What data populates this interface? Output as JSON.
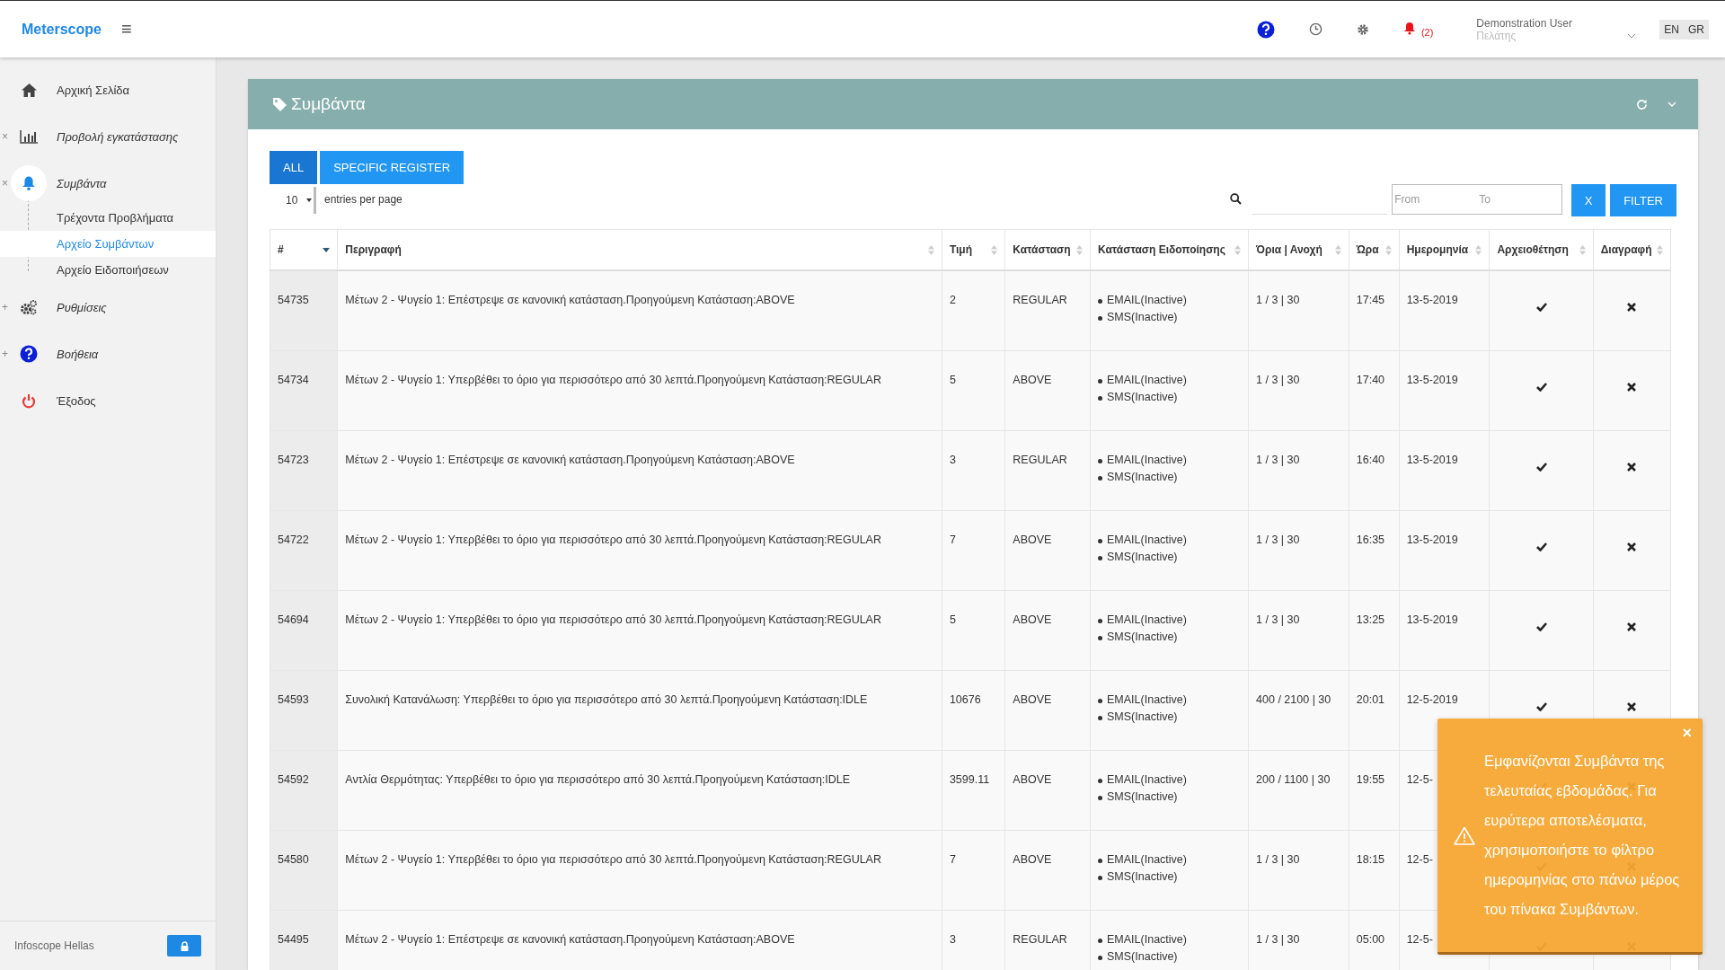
{
  "topbar": {
    "brand": "Meterscope",
    "menu": "≡",
    "notifications": "(2)",
    "user": {
      "name": "Demonstration User",
      "role": "Πελάτης"
    },
    "languages": [
      "EN",
      "GR"
    ]
  },
  "sidebar": {
    "items": [
      {
        "label": "Αρχική Σελίδα",
        "italic": false,
        "active": false
      },
      {
        "label": "Προβολή εγκατάστασης",
        "italic": true,
        "active": false,
        "toggle": "×"
      },
      {
        "label": "Συμβάντα",
        "italic": true,
        "active": true,
        "toggle": "×",
        "children": [
          {
            "label": "Τρέχοντα Προβλήματα",
            "selected": false
          },
          {
            "label": "Αρχείο Συμβάντων",
            "selected": true
          },
          {
            "label": "Αρχείο Ειδοποιήσεων",
            "selected": false
          }
        ]
      },
      {
        "label": "Ρυθμίσεις",
        "italic": true,
        "active": false,
        "toggle": "+"
      },
      {
        "label": "Βοήθεια",
        "italic": true,
        "active": false,
        "toggle": "+"
      },
      {
        "label": "Έξοδος",
        "italic": false,
        "active": false
      }
    ],
    "footer": "Infoscope Hellas"
  },
  "panel": {
    "title": "Συμβάντα",
    "tabs": [
      {
        "label": "ALL",
        "selected": true
      },
      {
        "label": "SPECIFIC REGISTER",
        "selected": false
      }
    ],
    "page_size": "10",
    "page_size_label": "entries per page",
    "from": {
      "placeholder": "From"
    },
    "to": {
      "placeholder": "To"
    },
    "clear_button": "X",
    "filter_button": "FILTER",
    "table": {
      "columns": [
        {
          "label": "#",
          "sorted": true
        },
        {
          "label": "Περιγραφή",
          "sorted": false
        },
        {
          "label": "Τιμή",
          "sorted": false
        },
        {
          "label": "Κατάσταση",
          "sorted": false
        },
        {
          "label": "Κατάσταση Ειδοποίησης",
          "sorted": false
        },
        {
          "label": "Όρια | Ανοχή",
          "sorted": false
        },
        {
          "label": "Ώρα",
          "sorted": false
        },
        {
          "label": "Ημερομηνία",
          "sorted": false
        },
        {
          "label": "Αρχειοθέτηση",
          "sorted": false
        },
        {
          "label": "Διαγραφή",
          "sorted": false
        }
      ],
      "rows": [
        {
          "id": "54735",
          "description": "Μέτων 2 - Ψυγείο 1: Επέστρεψε σε κανονική κατάσταση.Προηγούμενη Κατάσταση:ABOVE",
          "value": "2",
          "status": "REGULAR",
          "notifications": [
            "EMAIL(Inactive)",
            "SMS(Inactive)"
          ],
          "limits": "1 / 3 | 30",
          "time": "17:45",
          "date": "13-5-2019"
        },
        {
          "id": "54734",
          "description": "Μέτων 2 - Ψυγείο 1: Υπερβέθει το όριο για περισσότερο από 30 λεπτά.Προηγούμενη Κατάσταση:REGULAR",
          "value": "5",
          "status": "ABOVE",
          "notifications": [
            "EMAIL(Inactive)",
            "SMS(Inactive)"
          ],
          "limits": "1 / 3 | 30",
          "time": "17:40",
          "date": "13-5-2019"
        },
        {
          "id": "54723",
          "description": "Μέτων 2 - Ψυγείο 1: Επέστρεψε σε κανονική κατάσταση.Προηγούμενη Κατάσταση:ABOVE",
          "value": "3",
          "status": "REGULAR",
          "notifications": [
            "EMAIL(Inactive)",
            "SMS(Inactive)"
          ],
          "limits": "1 / 3 | 30",
          "time": "16:40",
          "date": "13-5-2019"
        },
        {
          "id": "54722",
          "description": "Μέτων 2 - Ψυγείο 1: Υπερβέθει το όριο για περισσότερο από 30 λεπτά.Προηγούμενη Κατάσταση:REGULAR",
          "value": "7",
          "status": "ABOVE",
          "notifications": [
            "EMAIL(Inactive)",
            "SMS(Inactive)"
          ],
          "limits": "1 / 3 | 30",
          "time": "16:35",
          "date": "13-5-2019"
        },
        {
          "id": "54694",
          "description": "Μέτων 2 - Ψυγείο 1: Υπερβέθει το όριο για περισσότερο από 30 λεπτά.Προηγούμενη Κατάσταση:REGULAR",
          "value": "5",
          "status": "ABOVE",
          "notifications": [
            "EMAIL(Inactive)",
            "SMS(Inactive)"
          ],
          "limits": "1 / 3 | 30",
          "time": "13:25",
          "date": "13-5-2019"
        },
        {
          "id": "54593",
          "description": "Συνολική Κατανάλωση: Υπερβέθει το όριο για περισσότερο από 30 λεπτά.Προηγούμενη Κατάσταση:IDLE",
          "value": "10676",
          "status": "ABOVE",
          "notifications": [
            "EMAIL(Inactive)",
            "SMS(Inactive)"
          ],
          "limits": "400 / 2100 | 30",
          "time": "20:01",
          "date": "12-5-2019"
        },
        {
          "id": "54592",
          "description": "Αντλία Θερμότητας: Υπερβέθει το όριο για περισσότερο από 30 λεπτά.Προηγούμενη Κατάσταση:IDLE",
          "value": "3599.11",
          "status": "ABOVE",
          "notifications": [
            "EMAIL(Inactive)",
            "SMS(Inactive)"
          ],
          "limits": "200 / 1100 | 30",
          "time": "19:55",
          "date": "12-5-"
        },
        {
          "id": "54580",
          "description": "Μέτων 2 - Ψυγείο 1: Υπερβέθει το όριο για περισσότερο από 30 λεπτά.Προηγούμενη Κατάσταση:REGULAR",
          "value": "7",
          "status": "ABOVE",
          "notifications": [
            "EMAIL(Inactive)",
            "SMS(Inactive)"
          ],
          "limits": "1 / 3 | 30",
          "time": "18:15",
          "date": "12-5-"
        },
        {
          "id": "54495",
          "description": "Μέτων 2 - Ψυγείο 1: Επέστρεψε σε κανονική κατάσταση.Προηγούμενη Κατάσταση:ABOVE",
          "value": "3",
          "status": "REGULAR",
          "notifications": [
            "EMAIL(Inactive)",
            "SMS(Inactive)"
          ],
          "limits": "1 / 3 | 30",
          "time": "05:00",
          "date": "12-5-"
        }
      ]
    }
  },
  "toast": {
    "message": "Εμφανίζονται Συμβάντα της τελευταίας εβδομάδας. Για ευρύτερα αποτελέσματα, χρησιμοποιήστε το φίλτρο ημερομηνίας στο πάνω μέρος του πίνακα Συμβάντων.",
    "close": "×"
  }
}
